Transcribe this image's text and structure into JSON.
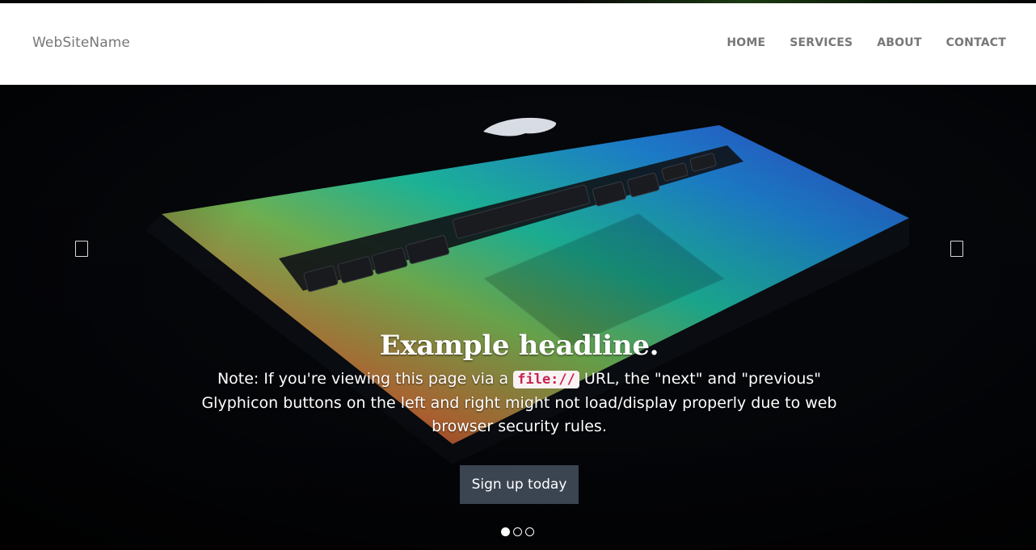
{
  "navbar": {
    "brand": "WebSiteName",
    "links": [
      "HOME",
      "SERVICES",
      "ABOUT",
      "CONTACT"
    ]
  },
  "carousel": {
    "headline": "Example headline.",
    "note_before": "Note: If you're viewing this page via a ",
    "note_code": "file://",
    "note_after": " URL, the \"next\" and \"previous\" Glyphicon buttons on the left and right might not load/display properly due to web browser security rules.",
    "cta_label": "Sign up today",
    "slide_count": 3,
    "active_slide": 1,
    "prev_icon": "chevron-left-icon",
    "next_icon": "chevron-right-icon"
  },
  "colors": {
    "cta_background": "#3b4451",
    "code_background": "#f9f2f4",
    "code_text": "#c7254e",
    "nav_text": "#777777"
  }
}
